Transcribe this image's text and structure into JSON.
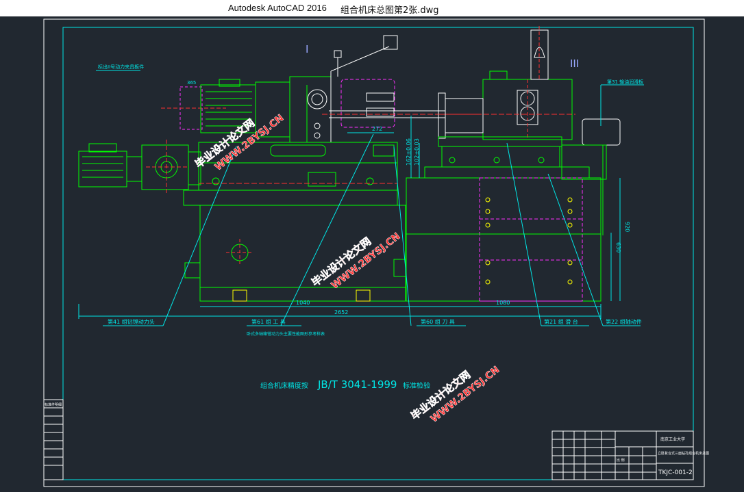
{
  "window": {
    "app_name": "Autodesk AutoCAD 2016",
    "file_name": "组合机床总图第2张.dwg"
  },
  "drawing": {
    "roman_1": "I",
    "roman_3": "III",
    "top_left_note": "标出II号动力夹具板件",
    "callout_31": "第31 输油润滑板",
    "dims": {
      "d365": "365",
      "d272": "272",
      "d162": "162±0.06",
      "d102": "102±0.03",
      "d920": "920",
      "d630": "630",
      "d1040": "1040",
      "d1080": "1080",
      "d2652": "2652"
    },
    "labels": {
      "l41": "第41 组钻镗动力头",
      "l61": "第61 组  工  具",
      "l61_sub": "卧式多轴箱镗动力头主要性能图形参考样表",
      "l60": "第60 组  刀  具",
      "l21": "第21 组  滑  台",
      "l22": "第22 组轴动件"
    },
    "standard_prefix": "组合机床精度按",
    "standard_code": "JB/T  3041-1999",
    "standard_suffix": "标准检验",
    "watermark_cn": "毕业设计论文网",
    "watermark_url": "WWW.2BYSJ.CN",
    "title_block": {
      "school": "南京工业大学",
      "project": "立卧复合式三面钻孔组合机床总图",
      "scale_label": "比 例",
      "drawing_no": "TKJC-001-2",
      "left_table_header": "标准件明细"
    }
  }
}
